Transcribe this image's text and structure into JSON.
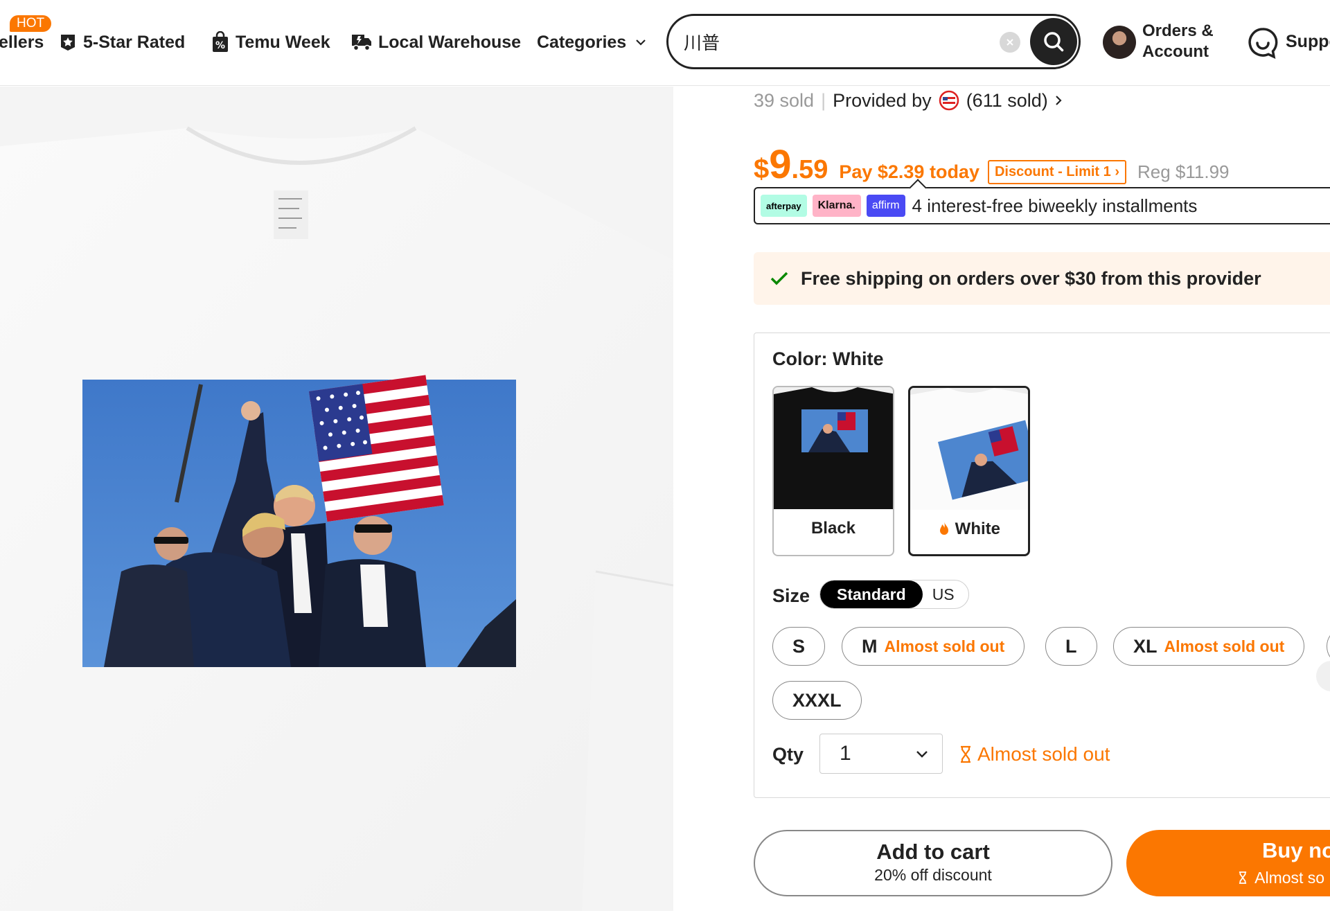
{
  "nav": {
    "hot_badge": "HOT",
    "items": [
      {
        "label": "ellers",
        "icon": "none"
      },
      {
        "label": "5-Star Rated",
        "icon": "star-badge-icon"
      },
      {
        "label": "Temu Week",
        "icon": "percent-bag-icon"
      },
      {
        "label": "Local Warehouse",
        "icon": "truck-icon"
      },
      {
        "label": "Categories",
        "icon": "chevron-down-icon"
      }
    ]
  },
  "search": {
    "value": "川普",
    "placeholder": ""
  },
  "account": {
    "orders_line1": "Orders &",
    "orders_line2": "Account",
    "support": "Suppo"
  },
  "product": {
    "sold_count": "39 sold",
    "separator": "|",
    "provided_by": "Provided by",
    "provider_sold": "(611 sold)",
    "price_symbol": "$",
    "price_int": "9",
    "price_dec": ".59",
    "pay_today": "Pay $2.39 today",
    "discount_tag": "Discount - Limit 1",
    "reg_price": "Reg $11.99",
    "bnpl": {
      "afterpay": "afterpay",
      "klarna": "Klarna.",
      "affirm": "affirm",
      "text": "4 interest-free biweekly installments"
    },
    "shipping": "Free shipping on orders over $30 from this provider",
    "color": {
      "label": "Color: White",
      "options": [
        {
          "name": "Black",
          "selected": false
        },
        {
          "name": "White",
          "selected": true
        }
      ]
    },
    "size": {
      "label": "Size",
      "toggle_active": "Standard",
      "toggle_inactive": "US",
      "options": [
        {
          "name": "S",
          "note": ""
        },
        {
          "name": "M",
          "note": "Almost sold out"
        },
        {
          "name": "L",
          "note": ""
        },
        {
          "name": "XL",
          "note": "Almost sold out"
        },
        {
          "name": "XXXL",
          "note": ""
        }
      ]
    },
    "qty": {
      "label": "Qty",
      "value": "1",
      "warning": "Almost sold out"
    },
    "add_to_cart": {
      "title": "Add to cart",
      "subtitle": "20% off discount"
    },
    "buy_now": {
      "title": "Buy no",
      "subtitle": "Almost so"
    }
  },
  "colors": {
    "accent": "#fb7701",
    "text": "#222222",
    "muted": "#999999",
    "shipping_bg": "#fff4ea"
  }
}
